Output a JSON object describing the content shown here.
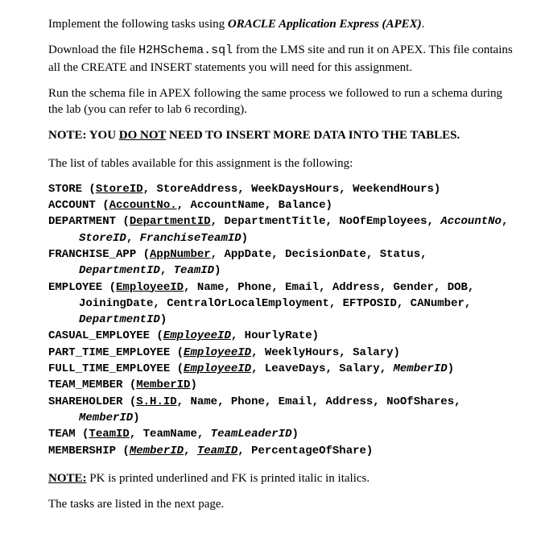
{
  "intro1_a": "Implement the following tasks using ",
  "intro1_em": "ORACLE Application Express (APEX)",
  "intro1_b": ".",
  "intro2_a": "Download the file ",
  "intro2_file": "H2HSchema.sql",
  "intro2_b": " from the LMS site and run it on APEX. This file contains all the CREATE and INSERT statements you will need for this assignment.",
  "intro3": "Run the schema file in APEX following the same process we followed to run a schema during the lab (you can refer to lab 6 recording).",
  "note_a": "NOTE: YOU ",
  "note_em": "DO NOT",
  "note_b": " NEED TO INSERT MORE DATA INTO THE TABLES.",
  "list_intro": "The list of tables available for this assignment is the following:",
  "tables": {
    "store": {
      "name": "STORE",
      "pk": "StoreID",
      "rest": ", StoreAddress, WeekDaysHours, WeekendHours)"
    },
    "account": {
      "name": "ACCOUNT",
      "pk": "AccountNo.",
      "rest": ", AccountName, Balance)"
    },
    "department": {
      "name": "DEPARTMENT",
      "pk": "DepartmentID",
      "rest1": ", DepartmentTitle, NoOfEmployees, ",
      "fk1": "AccountNo",
      "rest2": ", ",
      "fk2": "StoreID",
      "rest3": ", ",
      "fk3": "FranchiseTeamID",
      "rest4": ")"
    },
    "franchise": {
      "name": "FRANCHISE_APP",
      "pk": "AppNumber",
      "rest1": ", AppDate, DecisionDate, Status, ",
      "fk1": "DepartmentID",
      "rest2": ", ",
      "fk2": "TeamID",
      "rest3": ")"
    },
    "employee": {
      "name": "EMPLOYEE",
      "pk": "EmployeeID",
      "rest1": ", Name, Phone, Email, Address, Gender, DOB, JoiningDate, CentralOrLocalEmployment, EFTPOSID, CANumber, ",
      "fk1": "DepartmentID",
      "rest2": ")"
    },
    "casual": {
      "name": "CASUAL_EMPLOYEE",
      "pkfk": "EmployeeID",
      "rest": ", HourlyRate)"
    },
    "parttime": {
      "name": "PART_TIME_EMPLOYEE",
      "pkfk": "EmployeeID",
      "rest": ", WeeklyHours, Salary)"
    },
    "fulltime": {
      "name": "FULL_TIME_EMPLOYEE",
      "pkfk": "EmployeeID",
      "rest1": ", LeaveDays, Salary, ",
      "fk1": "MemberID",
      "rest2": ")"
    },
    "teammember": {
      "name": "TEAM_MEMBER",
      "pk": "MemberID",
      "rest": ")"
    },
    "shareholder": {
      "name": "SHAREHOLDER",
      "pk": "S.H.ID",
      "rest1": ", Name, Phone, Email, Address, NoOfShares, ",
      "fk1": "MemberID",
      "rest2": ")"
    },
    "team": {
      "name": "TEAM",
      "pk": "TeamID",
      "rest1": ", TeamName, ",
      "fk1": "TeamLeaderID",
      "rest2": ")"
    },
    "membership": {
      "name": "MEMBERSHIP",
      "pkfk1": "MemberID",
      "sep": ", ",
      "pkfk2": "TeamID",
      "rest": ", PercentageOfShare)"
    }
  },
  "footnote_a": "NOTE:",
  "footnote_b": " PK is printed underlined and FK is printed italic in italics.",
  "closing": "The tasks are listed in the next page."
}
